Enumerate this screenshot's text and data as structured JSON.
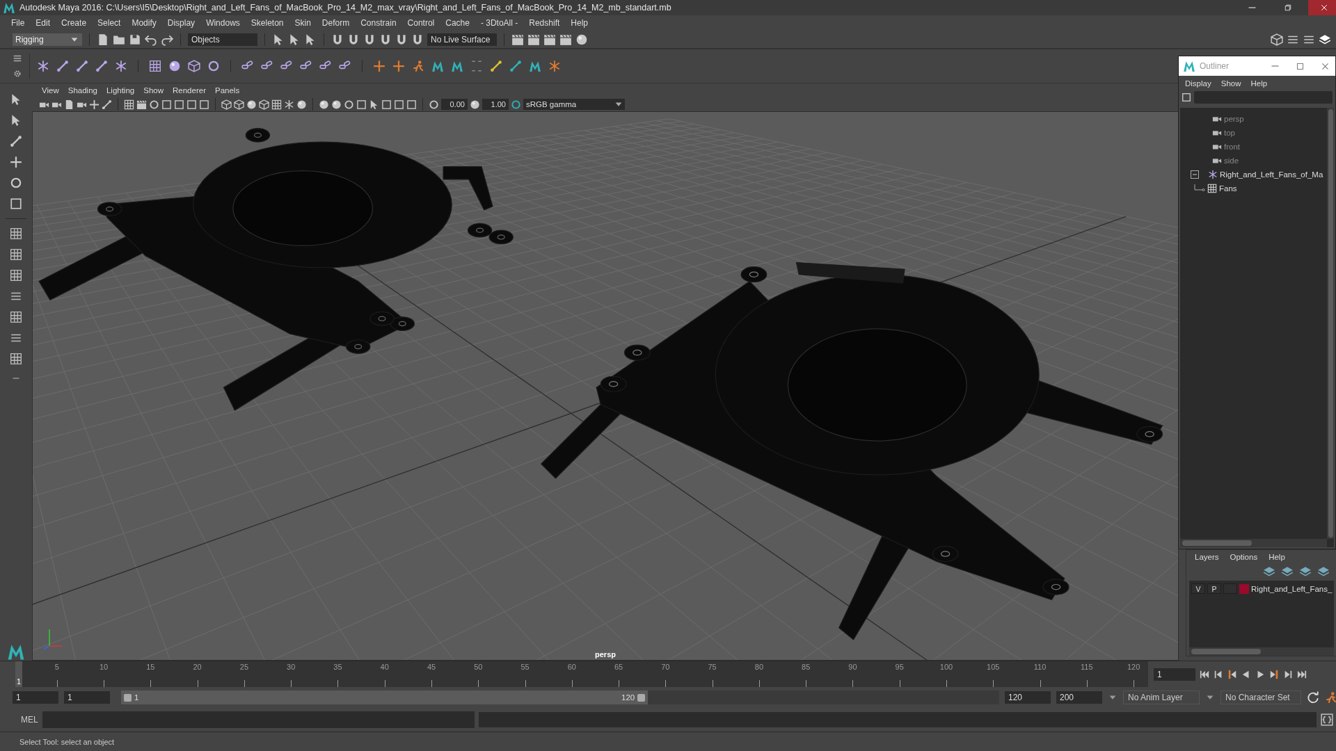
{
  "window": {
    "title": "Autodesk Maya 2016: C:\\Users\\I5\\Desktop\\Right_and_Left_Fans_of_MacBook_Pro_14_M2_max_vray\\Right_and_Left_Fans_of_MacBook_Pro_14_M2_mb_standart.mb"
  },
  "menu_bar": [
    "File",
    "Edit",
    "Create",
    "Select",
    "Modify",
    "Display",
    "Windows",
    "Skeleton",
    "Skin",
    "Deform",
    "Constrain",
    "Control",
    "Cache",
    "- 3DtoAll -",
    "Redshift",
    "Help"
  ],
  "status_line": {
    "mode_menu": "Rigging",
    "selection_mode": "Objects",
    "live_surface": "No Live Surface"
  },
  "viewport": {
    "menus": [
      "View",
      "Shading",
      "Lighting",
      "Show",
      "Renderer",
      "Panels"
    ],
    "exposure": "0.00",
    "gamma": "1.00",
    "color_space": "sRGB gamma",
    "camera_label": "persp"
  },
  "outliner": {
    "title": "Outliner",
    "menus": [
      "Display",
      "Show",
      "Help"
    ],
    "items": [
      {
        "label": "persp",
        "kind": "camera",
        "dimmed": true
      },
      {
        "label": "top",
        "kind": "camera",
        "dimmed": true
      },
      {
        "label": "front",
        "kind": "camera",
        "dimmed": true
      },
      {
        "label": "side",
        "kind": "camera",
        "dimmed": true
      },
      {
        "label": "Right_and_Left_Fans_of_Ma",
        "kind": "group",
        "dimmed": false,
        "expanded": true,
        "children": [
          {
            "label": "Fans",
            "kind": "mesh",
            "dimmed": false
          }
        ]
      }
    ]
  },
  "layers": {
    "menus": [
      "Layers",
      "Options",
      "Help"
    ],
    "rows": [
      {
        "visible": "V",
        "playback": "P",
        "color": "#9b0a2a",
        "name": "Right_and_Left_Fans_"
      }
    ]
  },
  "timeline": {
    "current_frame": "1",
    "level": 0,
    "ticks": [
      "5",
      "10",
      "15",
      "20",
      "25",
      "30",
      "35",
      "40",
      "45",
      "50",
      "55",
      "60",
      "65",
      "70",
      "75",
      "80",
      "85",
      "90",
      "95",
      "100",
      "105",
      "110",
      "115",
      "120"
    ],
    "frame_field": "1"
  },
  "range": {
    "start": "1",
    "playback_start": "1",
    "slider_start": "1",
    "slider_end": "120",
    "level": 0.6,
    "playback_end": "120",
    "end": "200",
    "anim_layer": "No Anim Layer",
    "character_set": "No Character Set"
  },
  "command_line": {
    "language": "MEL"
  },
  "help_line": "Select Tool: select an object"
}
